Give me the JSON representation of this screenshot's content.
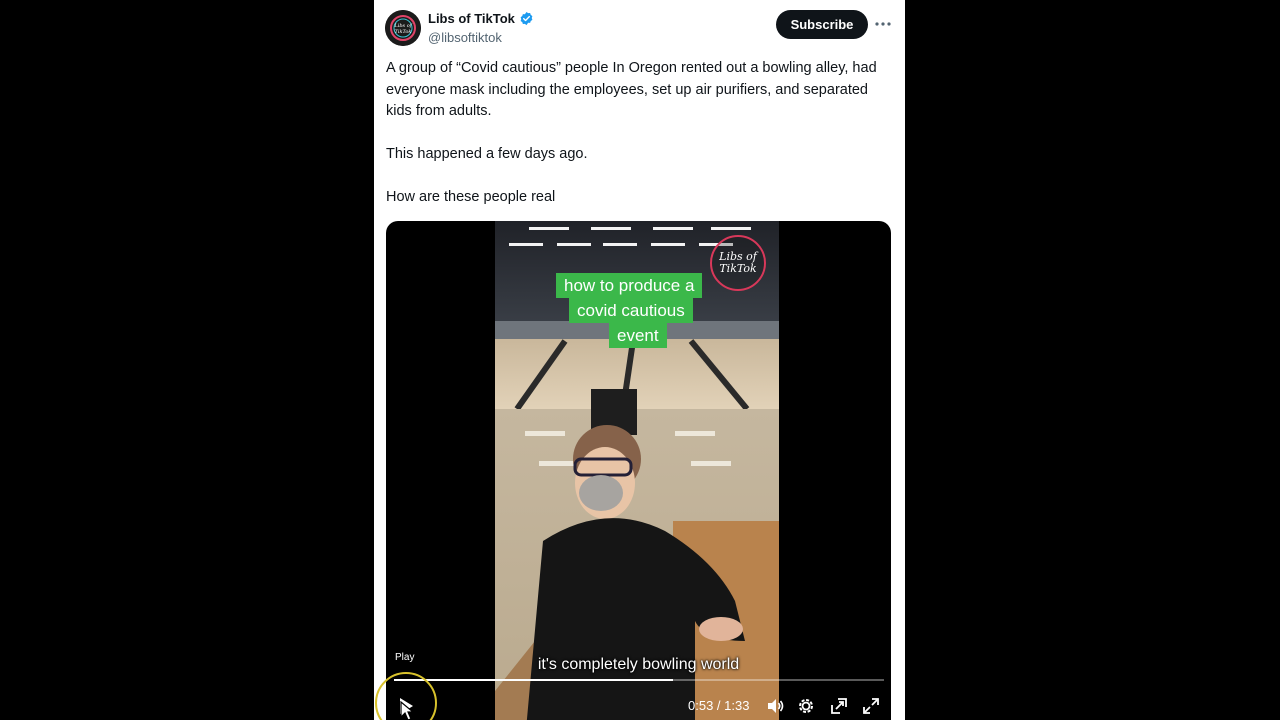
{
  "author": {
    "name": "Libs of TikTok",
    "handle": "@libsoftiktok",
    "avatar_text": "Libs of TikTok",
    "verified": true
  },
  "header": {
    "subscribe_label": "Subscribe",
    "more_icon": "more-horizontal-icon"
  },
  "tweet": {
    "paragraphs": [
      "A group of “Covid cautious” people In Oregon rented out a bowling alley, had everyone mask including the employees, set up air purifiers, and separated kids from adults.",
      "This happened a few days ago.",
      "How are these people real"
    ]
  },
  "video": {
    "caption_lines": [
      "how to produce a",
      "covid cautious",
      "event"
    ],
    "watermark_line1": "Libs of",
    "watermark_line2": "TikTok",
    "subtitle": "it's completely bowling world",
    "play_tooltip": "Play",
    "time_current": "0:53",
    "time_separator": " / ",
    "time_total": "1:33",
    "progress_fraction": 0.57,
    "controls": [
      "play-icon",
      "volume-icon",
      "settings-icon",
      "picture-in-picture-icon",
      "fullscreen-icon"
    ]
  },
  "colors": {
    "accent_verified": "#1d9bf0",
    "caption_green": "#3bb84a",
    "cursor_ring": "#d8c22c"
  }
}
